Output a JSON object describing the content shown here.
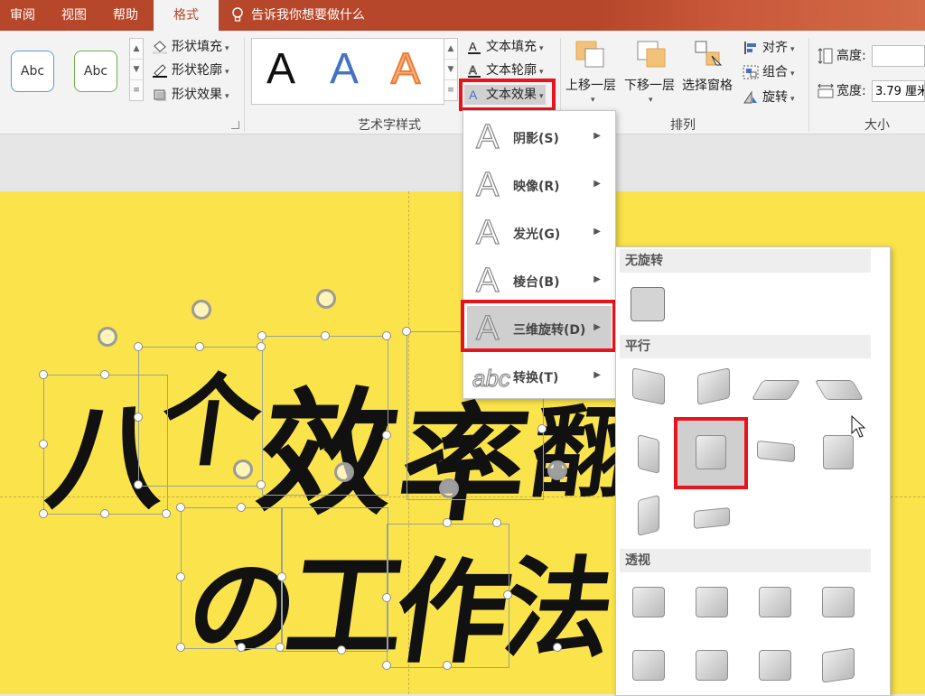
{
  "tabs": [
    {
      "label": "审阅",
      "active": false
    },
    {
      "label": "视图",
      "active": false
    },
    {
      "label": "帮助",
      "active": false
    },
    {
      "label": "格式",
      "active": true
    }
  ],
  "tell_me": "告诉我你想要做什么",
  "ribbon": {
    "shape_styles": {
      "preset1": "Abc",
      "preset2": "Abc",
      "fill": "形状填充",
      "outline": "形状轮廓",
      "effects": "形状效果"
    },
    "wordart": {
      "group_label": "艺术字样式",
      "preset_letter": "A",
      "text_fill": "文本填充",
      "text_outline": "文本轮廓",
      "text_effects": "文本效果"
    },
    "arrange": {
      "group_label": "排列",
      "bring_forward": "上移一层",
      "send_backward": "下移一层",
      "selection_pane": "选择窗格",
      "align": "对齐",
      "group": "组合",
      "rotate": "旋转"
    },
    "size": {
      "group_label": "大小",
      "height_label": "高度:",
      "height_value": "",
      "width_label": "宽度:",
      "width_value": "3.79 厘米"
    }
  },
  "slide": {
    "line1": [
      "八",
      "个",
      "效",
      "率",
      "翻"
    ],
    "line2": [
      "の",
      "工",
      "作",
      "法"
    ]
  },
  "text_effects_menu": [
    {
      "label": "阴影(S)",
      "icon": "A"
    },
    {
      "label": "映像(R)",
      "icon": "A"
    },
    {
      "label": "发光(G)",
      "icon": "A"
    },
    {
      "label": "棱台(B)",
      "icon": "A"
    },
    {
      "label": "三维旋转(D)",
      "icon": "A"
    },
    {
      "label": "转换(T)",
      "icon": "abc"
    }
  ],
  "rotation_submenu": {
    "no_rotation": "无旋转",
    "parallel": "平行",
    "perspective": "透视"
  },
  "colors": {
    "accent": "#b7472a",
    "slide_bg": "#fae34b",
    "highlight": "#e8141b"
  }
}
